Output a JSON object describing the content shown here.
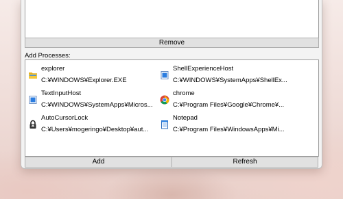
{
  "buttons": {
    "remove": "Remove",
    "add": "Add",
    "refresh": "Refresh"
  },
  "labels": {
    "add_processes": "Add Processes:"
  },
  "processes": [
    {
      "name": "explorer",
      "path": "C:¥WINDOWS¥Explorer.EXE",
      "icon": "folder-icon"
    },
    {
      "name": "ShellExperienceHost",
      "path": "C:¥WINDOWS¥SystemApps¥ShellEx...",
      "icon": "app-window-icon"
    },
    {
      "name": "TextInputHost",
      "path": "C:¥WINDOWS¥SystemApps¥Micros...",
      "icon": "app-window-icon"
    },
    {
      "name": "chrome",
      "path": "C:¥Program Files¥Google¥Chrome¥...",
      "icon": "chrome-icon"
    },
    {
      "name": "AutoCursorLock",
      "path": "C:¥Users¥mogeringo¥Desktop¥aut...",
      "icon": "lock-icon"
    },
    {
      "name": "Notepad",
      "path": "C:¥Program Files¥WindowsApps¥Mi...",
      "icon": "notepad-icon"
    }
  ],
  "colors": {
    "accent": "#0078d4",
    "window_bg": "#f3f3f3",
    "button_bg": "#e1e1e1"
  }
}
